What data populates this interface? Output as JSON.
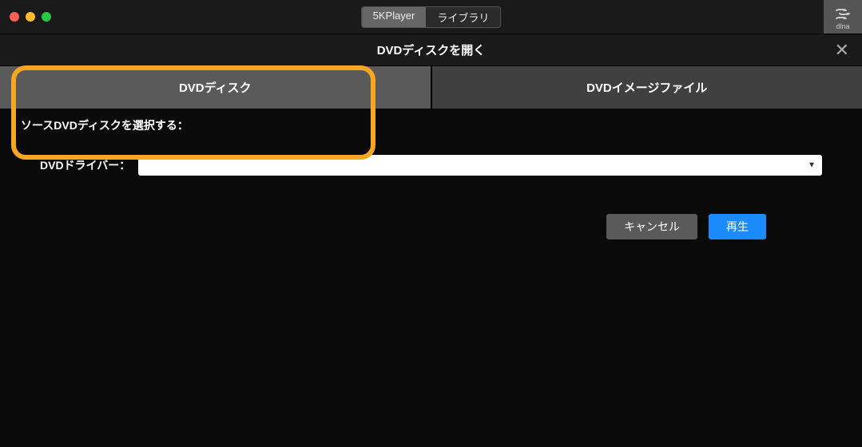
{
  "titlebar": {
    "toggle": {
      "left": "5KPlayer",
      "right": "ライブラリ"
    },
    "dlna_label": "dlna"
  },
  "dialog": {
    "title": "DVDディスクを開く",
    "tabs": {
      "disc": "DVDディスク",
      "image": "DVDイメージファイル"
    },
    "source_label": "ソースDVDディスクを選択する：",
    "driver_label": "DVDドライバー：",
    "driver_value": "",
    "buttons": {
      "cancel": "キャンセル",
      "play": "再生"
    }
  }
}
